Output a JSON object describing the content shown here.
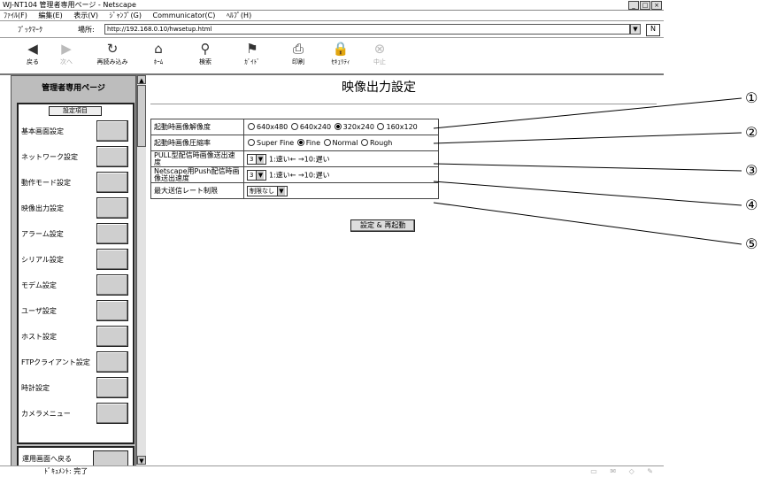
{
  "window": {
    "title": "WJ-NT104 管理者専用ページ - Netscape",
    "buttons": [
      "_",
      "□",
      "×"
    ]
  },
  "menu": [
    "ﾌｧｲﾙ(F)",
    "編集(E)",
    "表示(V)",
    "ｼﾞｬﾝﾌﾟ(G)",
    "Communicator(C)",
    "ﾍﾙﾌﾟ(H)"
  ],
  "location": {
    "bookmarks": "ﾌﾞｯｸﾏｰｸ",
    "label": "場所:",
    "url": "http://192.168.0.10/hwsetup.html"
  },
  "toolbar": [
    {
      "icon": "back-icon",
      "label": "戻る"
    },
    {
      "icon": "forward-icon",
      "label": "次へ"
    },
    {
      "icon": "reload-icon",
      "label": "再読み込み"
    },
    {
      "icon": "home-icon",
      "label": "ﾎｰﾑ"
    },
    {
      "icon": "search-icon",
      "label": "検索"
    },
    {
      "icon": "guide-icon",
      "label": "ｶﾞｲﾄﾞ"
    },
    {
      "icon": "print-icon",
      "label": "印刷"
    },
    {
      "icon": "security-icon",
      "label": "ｾｷｭﾘﾃｨ"
    },
    {
      "icon": "stop-icon",
      "label": "中止"
    }
  ],
  "sidebar": {
    "header": "管理者専用ページ",
    "section_title": "設定項目",
    "items": [
      {
        "label": "基本画面設定"
      },
      {
        "label": "ネットワーク設定"
      },
      {
        "label": "動作モード設定"
      },
      {
        "label": "映像出力設定"
      },
      {
        "label": "アラーム設定"
      },
      {
        "label": "シリアル設定"
      },
      {
        "label": "モデム設定"
      },
      {
        "label": "ユーザ設定"
      },
      {
        "label": "ホスト設定"
      },
      {
        "label": "FTPクライアント設定"
      },
      {
        "label": "時計設定"
      },
      {
        "label": "カメラメニュー"
      }
    ],
    "back_label": "運用画面へ戻る"
  },
  "main": {
    "title": "映像出力設定",
    "rows": [
      {
        "label": "起動時画像解像度",
        "options": [
          "640x480",
          "640x240",
          "320x240",
          "160x120"
        ],
        "selected": 2
      },
      {
        "label": "起動時画像圧縮率",
        "options": [
          "Super Fine",
          "Fine",
          "Normal",
          "Rough"
        ],
        "selected": 1
      },
      {
        "label": "PULL型配信時画像送出速度",
        "select_value": "3",
        "hint": "1:速い← →10:遅い"
      },
      {
        "label": "Netscape用Push配信時画像送出速度",
        "select_value": "3",
        "hint": "1:速い← →10:遅い"
      },
      {
        "label": "最大送信レート制限",
        "select_value": "制限なし"
      }
    ],
    "submit_label": "設定 & 再起動"
  },
  "status": {
    "text": "ﾄﾞｷｭﾒﾝﾄ: 完了"
  },
  "callouts": [
    "①",
    "②",
    "③",
    "④",
    "⑤"
  ]
}
